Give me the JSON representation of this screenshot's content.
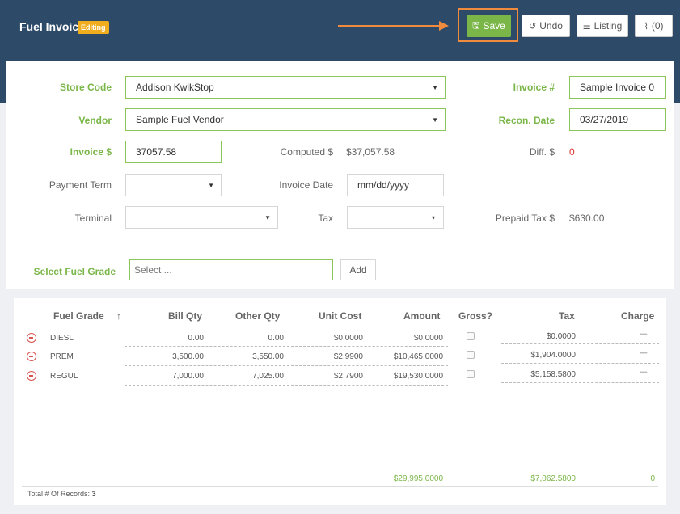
{
  "header": {
    "title": "Fuel Invoice",
    "status_badge": "Editing",
    "save_label": "Save",
    "undo_label": "Undo",
    "listing_label": "Listing",
    "attachments_label": "(0)"
  },
  "form": {
    "store_code": {
      "label": "Store Code",
      "value": "Addison KwikStop"
    },
    "vendor": {
      "label": "Vendor",
      "value": "Sample Fuel Vendor"
    },
    "invoice_amount": {
      "label": "Invoice $",
      "value": "37057.58"
    },
    "computed": {
      "label": "Computed $",
      "value": "$37,057.58"
    },
    "diff": {
      "label": "Diff. $",
      "value": "0"
    },
    "invoice_no": {
      "label": "Invoice #",
      "value": "Sample Invoice 0"
    },
    "recon_date": {
      "label": "Recon. Date",
      "value": "03/27/2019"
    },
    "payment_term": {
      "label": "Payment Term",
      "value": ""
    },
    "invoice_date": {
      "label": "Invoice Date",
      "placeholder": "mm/dd/yyyy"
    },
    "terminal": {
      "label": "Terminal",
      "value": ""
    },
    "tax": {
      "label": "Tax",
      "value": ""
    },
    "prepaid_tax": {
      "label": "Prepaid Tax $",
      "value": "$630.00"
    },
    "fuel_grade_select": {
      "label": "Select Fuel Grade",
      "placeholder": "Select ..."
    },
    "add_label": "Add"
  },
  "table": {
    "columns": [
      "Fuel Grade",
      "Bill Qty",
      "Other Qty",
      "Unit Cost",
      "Amount",
      "Gross?",
      "Tax",
      "Charge"
    ],
    "sort_indicator": "↑",
    "rows": [
      {
        "grade": "DIESL",
        "bill_qty": "0.00",
        "other_qty": "0.00",
        "unit_cost": "$0.0000",
        "amount": "$0.0000",
        "tax": "$0.0000",
        "charge": "••••••"
      },
      {
        "grade": "PREM",
        "bill_qty": "3,500.00",
        "other_qty": "3,550.00",
        "unit_cost": "$2.9900",
        "amount": "$10,465.0000",
        "tax": "$1,904.0000",
        "charge": "••••••"
      },
      {
        "grade": "REGUL",
        "bill_qty": "7,000.00",
        "other_qty": "7,025.00",
        "unit_cost": "$2.7900",
        "amount": "$19,530.0000",
        "tax": "$5,158.5800",
        "charge": "••••••"
      }
    ],
    "totals": {
      "amount": "$29,995.0000",
      "tax": "$7,062.5800",
      "charge": "0"
    },
    "footer_label": "Total # Of Records:",
    "footer_count": "3"
  },
  "colors": {
    "header_bg": "#2d4a68",
    "accent_green": "#7ab648",
    "badge": "#f0ad1e",
    "highlight": "#f08a3c",
    "error_red": "#d9534f"
  }
}
